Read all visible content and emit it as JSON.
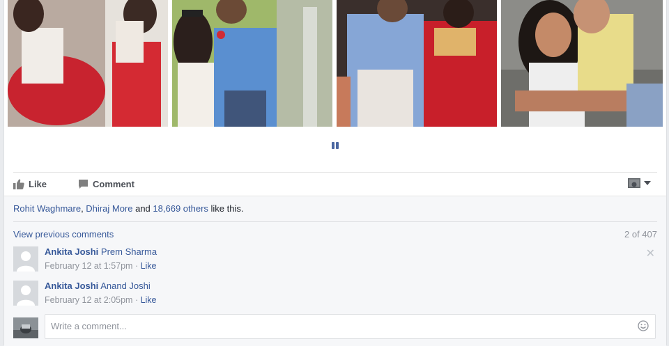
{
  "post": {
    "photos": [
      {
        "icon": "couple-photo-1"
      },
      {
        "icon": "couple-photo-2"
      },
      {
        "icon": "couple-photo-3"
      },
      {
        "icon": "couple-photo-4"
      }
    ],
    "pager_icon": "pause-icon"
  },
  "actions": {
    "like_label": "Like",
    "comment_label": "Comment",
    "share_menu_icon": "audience-icon"
  },
  "likes": {
    "name1": "Rohit Waghmare",
    "sep": ", ",
    "name2": "Dhiraj More",
    "and": " and ",
    "others": "18,669 others",
    "suffix": " like this."
  },
  "comments": {
    "view_previous": "View previous comments",
    "count": "2 of 407",
    "items": [
      {
        "author": "Ankita Joshi",
        "text": "Prem Sharma",
        "time": "February 12 at 1:57pm",
        "dot": " · ",
        "like": "Like"
      },
      {
        "author": "Ankita Joshi",
        "text": "Anand Joshi",
        "time": "February 12 at 2:05pm",
        "dot": " · ",
        "like": "Like"
      }
    ]
  },
  "composer": {
    "placeholder": "Write a comment..."
  },
  "colors": {
    "link": "#365899",
    "meta": "#90949c",
    "background": "#f6f7f9"
  }
}
